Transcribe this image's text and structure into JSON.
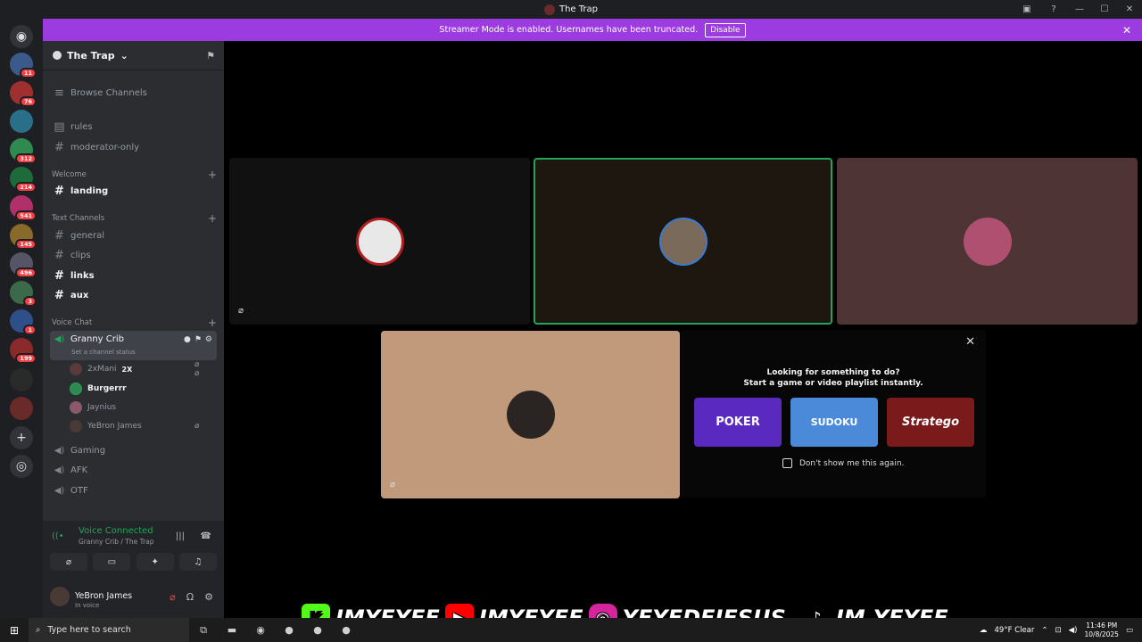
{
  "window": {
    "title": "The Trap"
  },
  "banner": {
    "text": "Streamer Mode is enabled. Usernames have been truncated.",
    "button": "Disable"
  },
  "guild_badges": [
    "11",
    "11",
    "76",
    "312",
    "214",
    "541",
    "145",
    "496",
    "3",
    "1",
    "199"
  ],
  "server": {
    "name": "The Trap"
  },
  "sidebar": {
    "browse": "Browse Channels",
    "top_channels": [
      "rules",
      "moderator-only"
    ],
    "welcome_cat": "Welcome",
    "welcome_channels": [
      "landing"
    ],
    "text_cat": "Text Channels",
    "text_channels": [
      "general",
      "clips",
      "links",
      "aux"
    ],
    "voice_cat": "Voice Chat",
    "active_voice": {
      "name": "Granny Crib",
      "status": "Set a channel status"
    },
    "voice_users": [
      {
        "name": "2xMani",
        "extra": "2X"
      },
      {
        "name": "Burgerrr"
      },
      {
        "name": "Jaynius"
      },
      {
        "name": "YeBron James"
      }
    ],
    "other_voice": [
      "Gaming",
      "AFK",
      "OTF"
    ]
  },
  "voice_panel": {
    "status": "Voice Connected",
    "location": "Granny Crib / The Trap"
  },
  "user": {
    "name": "YeBron James",
    "status": "In voice"
  },
  "activity": {
    "heading1": "Looking for something to do?",
    "heading2": "Start a game or video playlist instantly.",
    "games": [
      "POKER",
      "SUDOKU",
      "Stratego"
    ],
    "checkbox": "Don't show me this again."
  },
  "socials": [
    "IMYEYEE",
    "IMYEYEE",
    "YEYEDEJESUS_",
    "IM.YEYEE"
  ],
  "taskbar": {
    "search": "Type here to search",
    "weather": "49°F Clear",
    "time": "11:46 PM",
    "date": "10/8/2025"
  },
  "colors": {
    "accent": "#9b3be0",
    "green": "#23a55a",
    "red": "#f23f43"
  }
}
